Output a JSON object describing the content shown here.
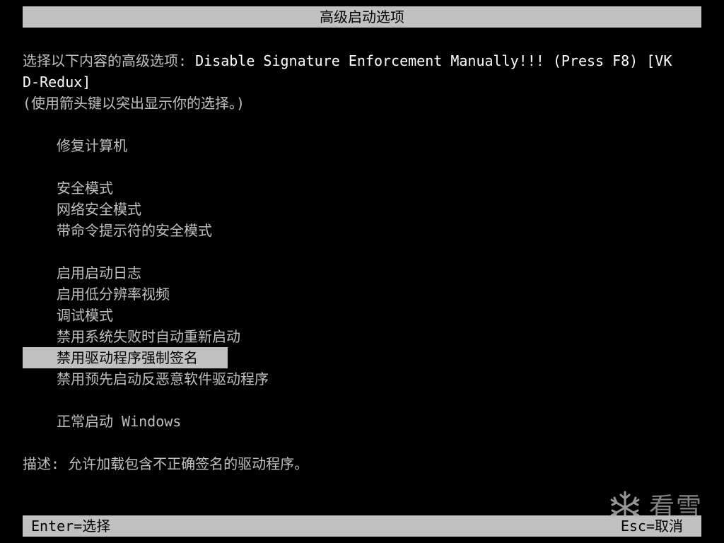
{
  "header": {
    "title": "高级启动选项"
  },
  "prompt": {
    "label": "选择以下内容的高级选项: ",
    "option_line1": "Disable Signature Enforcement Manually!!! (Press F8) [VK",
    "option_line2": "D-Redux]",
    "instruction": "(使用箭头键以突出显示你的选择。)"
  },
  "menu": {
    "items": [
      {
        "label": "修复计算机"
      },
      {
        "label": "安全模式"
      },
      {
        "label": "网络安全模式"
      },
      {
        "label": "带命令提示符的安全模式"
      },
      {
        "label": "启用启动日志"
      },
      {
        "label": "启用低分辨率视频"
      },
      {
        "label": "调试模式"
      },
      {
        "label": "禁用系统失败时自动重新启动"
      },
      {
        "label": "禁用驱动程序强制签名",
        "selected": true
      },
      {
        "label": "禁用预先启动反恶意软件驱动程序"
      },
      {
        "label": "正常启动 Windows"
      }
    ]
  },
  "description": {
    "text": "描述: 允许加载包含不正确签名的驱动程序。"
  },
  "footer": {
    "left": "Enter=选择",
    "right": "Esc=取消"
  },
  "watermark": {
    "icon": "snowflake-icon",
    "text": "看雪"
  },
  "colors": {
    "background": "#000000",
    "text": "#c0c0c0",
    "highlight_text": "#ffffff",
    "bar": "#c0c0c0",
    "bar_text": "#000000"
  }
}
